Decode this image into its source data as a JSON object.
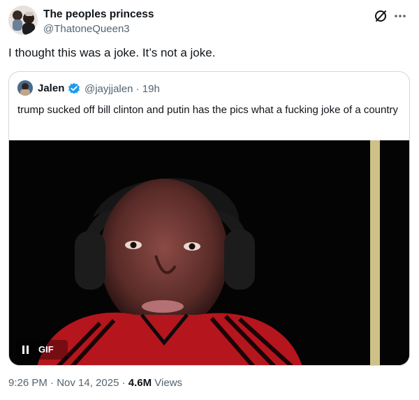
{
  "author": {
    "display_name": "The peoples princess",
    "handle": "@ThatoneQueen3",
    "avatar_icon": "avatar"
  },
  "header_actions": {
    "grok_icon": "grok-icon",
    "more_icon": "more-icon"
  },
  "tweet": {
    "text": "I thought this was a joke. It’s not a joke."
  },
  "quote": {
    "display_name": "Jalen",
    "verified_icon": "verified-icon",
    "verified_color": "#1d9bf0",
    "handle_time": "@jayjjalen · 19h",
    "text": "trump sucked off bill clinton and putin has the pics what a fucking joke of a country",
    "media": {
      "type": "GIF",
      "badge": "GIF",
      "control_icon": "pause-icon"
    }
  },
  "meta": {
    "timestamp": "9:26 PM · Nov 14, 2025 · ",
    "views_count": "4.6M",
    "views_label": " Views"
  },
  "colors": {
    "text_primary": "#0f1419",
    "text_secondary": "#536471",
    "border": "#cfd9de",
    "accent_blue": "#1d9bf0"
  }
}
